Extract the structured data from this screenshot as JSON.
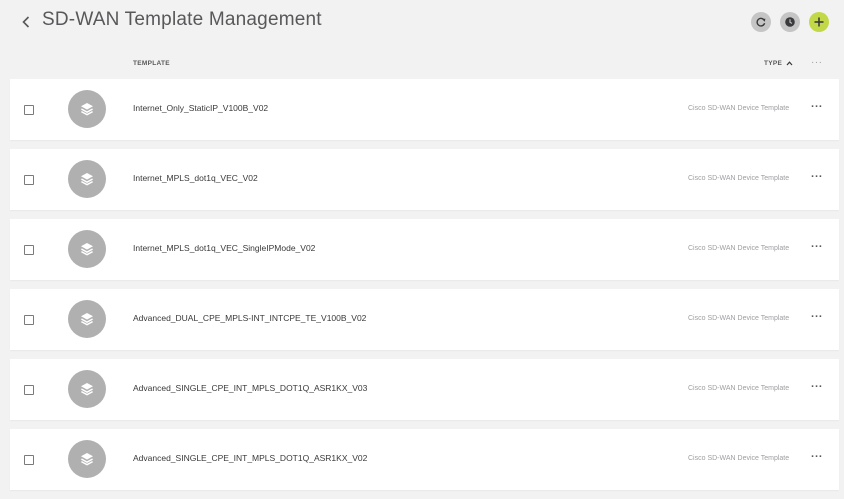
{
  "header": {
    "title": "SD-WAN Template Management",
    "back_icon": "chevron-left-icon",
    "buttons": [
      {
        "icon": "refresh-icon",
        "color": "#c5c5c5"
      },
      {
        "icon": "history-icon",
        "color": "#c5c5c5"
      },
      {
        "icon": "plus-icon",
        "color": "#c3d847"
      }
    ]
  },
  "columns": {
    "template": "TEMPLATE",
    "type": "TYPE",
    "more": "···"
  },
  "rows": [
    {
      "name": "Internet_Only_StaticIP_V100B_V02",
      "type": "Cisco SD-WAN Device Template",
      "more": "···"
    },
    {
      "name": "Internet_MPLS_dot1q_VEC_V02",
      "type": "Cisco SD-WAN Device Template",
      "more": "···"
    },
    {
      "name": "Internet_MPLS_dot1q_VEC_SingleIPMode_V02",
      "type": "Cisco SD-WAN Device Template",
      "more": "···"
    },
    {
      "name": "Advanced_DUAL_CPE_MPLS-INT_INTCPE_TE_V100B_V02",
      "type": "Cisco SD-WAN Device Template",
      "more": "···"
    },
    {
      "name": "Advanced_SINGLE_CPE_INT_MPLS_DOT1Q_ASR1KX_V03",
      "type": "Cisco SD-WAN Device Template",
      "more": "···"
    },
    {
      "name": "Advanced_SINGLE_CPE_INT_MPLS_DOT1Q_ASR1KX_V02",
      "type": "Cisco SD-WAN Device Template",
      "more": "···"
    }
  ],
  "colors": {
    "background": "#f2f2f2",
    "row": "#ffffff",
    "avatar": "#b0b0b0",
    "add_button": "#c3d847",
    "header_button": "#c5c5c5"
  }
}
